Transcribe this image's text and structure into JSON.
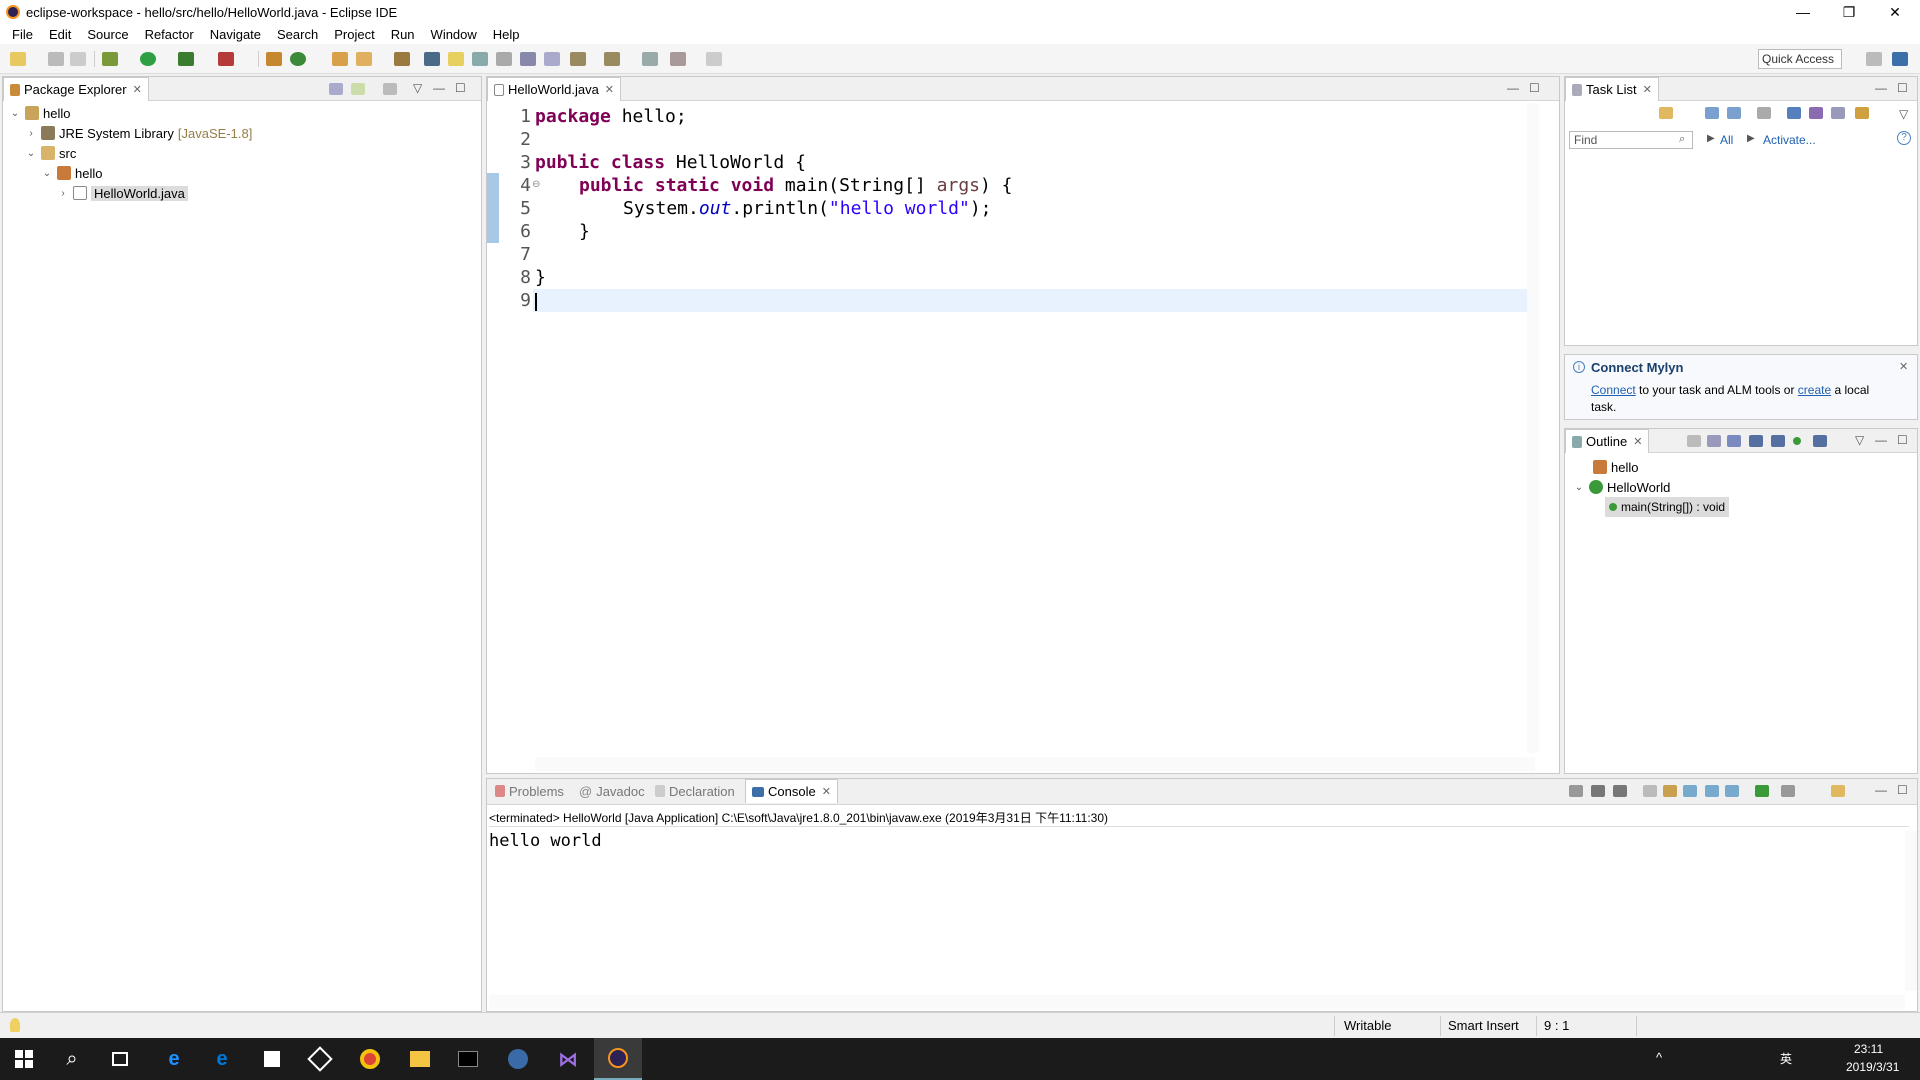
{
  "window": {
    "title": "eclipse-workspace - hello/src/hello/HelloWorld.java - Eclipse IDE",
    "controls": {
      "minimize": "—",
      "restore": "❐",
      "close": "✕"
    }
  },
  "menu": [
    "File",
    "Edit",
    "Source",
    "Refactor",
    "Navigate",
    "Search",
    "Project",
    "Run",
    "Window",
    "Help"
  ],
  "toolbar": {
    "quick_access": "Quick Access"
  },
  "package_explorer": {
    "tab": "Package Explorer",
    "tree": {
      "project": "hello",
      "jre": "JRE System Library",
      "jre_version": "[JavaSE-1.8]",
      "src": "src",
      "package": "hello",
      "file": "HelloWorld.java"
    }
  },
  "editor": {
    "tab": "HelloWorld.java",
    "line_numbers": [
      "1",
      "2",
      "3",
      "4",
      "5",
      "6",
      "7",
      "8",
      "9"
    ],
    "code": {
      "l1_kw": "package",
      "l1_rest": " hello;",
      "l3_kw": "public class",
      "l3_rest": " HelloWorld {",
      "l4_kw": "public static void",
      "l4_mid": " main(String[] ",
      "l4_param": "args",
      "l4_end": ") {",
      "l5_a": "System.",
      "l5_field": "out",
      "l5_b": ".println(",
      "l5_str": "\"hello world\"",
      "l5_c": ");",
      "l6": "}",
      "l8": "}"
    }
  },
  "task_list": {
    "tab": "Task List",
    "find_placeholder": "Find",
    "all": "All",
    "activate": "Activate..."
  },
  "mylyn": {
    "title": "Connect Mylyn",
    "connect": "Connect",
    "text1": " to your task and ALM tools or ",
    "create": "create",
    "text2": " a local",
    "text3": "task."
  },
  "outline": {
    "tab": "Outline",
    "package": "hello",
    "class": "HelloWorld",
    "method": "main(String[]) : void"
  },
  "bottom_tabs": {
    "problems": "Problems",
    "javadoc": "Javadoc",
    "declaration": "Declaration",
    "console": "Console"
  },
  "console": {
    "header": "<terminated> HelloWorld [Java Application] C:\\E\\soft\\Java\\jre1.8.0_201\\bin\\javaw.exe (2019年3月31日 下午11:11:30)",
    "output": "hello world"
  },
  "status": {
    "writable": "Writable",
    "insert": "Smart Insert",
    "position": "9 : 1"
  },
  "taskbar": {
    "time": "23:11",
    "date": "2019/3/31",
    "ime": "英",
    "colors": {
      "chrome": "#db4437",
      "edge": "#0078d7",
      "folder": "#f4c542"
    }
  }
}
